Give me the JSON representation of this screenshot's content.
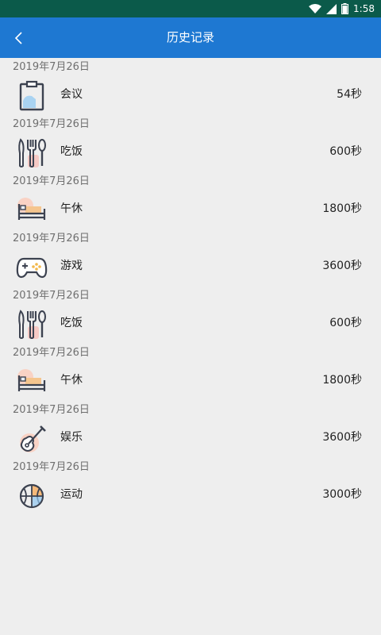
{
  "status": {
    "time": "1:58"
  },
  "header": {
    "title": "历史记录"
  },
  "records": [
    {
      "date": "2019年7月26日",
      "name": "会议",
      "duration": "54秒",
      "icon": "clipboard-icon"
    },
    {
      "date": "2019年7月26日",
      "name": "吃饭",
      "duration": "600秒",
      "icon": "utensils-icon"
    },
    {
      "date": "2019年7月26日",
      "name": "午休",
      "duration": "1800秒",
      "icon": "bed-icon"
    },
    {
      "date": "2019年7月26日",
      "name": "游戏",
      "duration": "3600秒",
      "icon": "gamepad-icon"
    },
    {
      "date": "2019年7月26日",
      "name": "吃饭",
      "duration": "600秒",
      "icon": "utensils-icon"
    },
    {
      "date": "2019年7月26日",
      "name": "午休",
      "duration": "1800秒",
      "icon": "bed-icon"
    },
    {
      "date": "2019年7月26日",
      "name": "娱乐",
      "duration": "3600秒",
      "icon": "guitar-icon"
    },
    {
      "date": "2019年7月26日",
      "name": "运动",
      "duration": "3000秒",
      "icon": "basketball-icon"
    }
  ]
}
